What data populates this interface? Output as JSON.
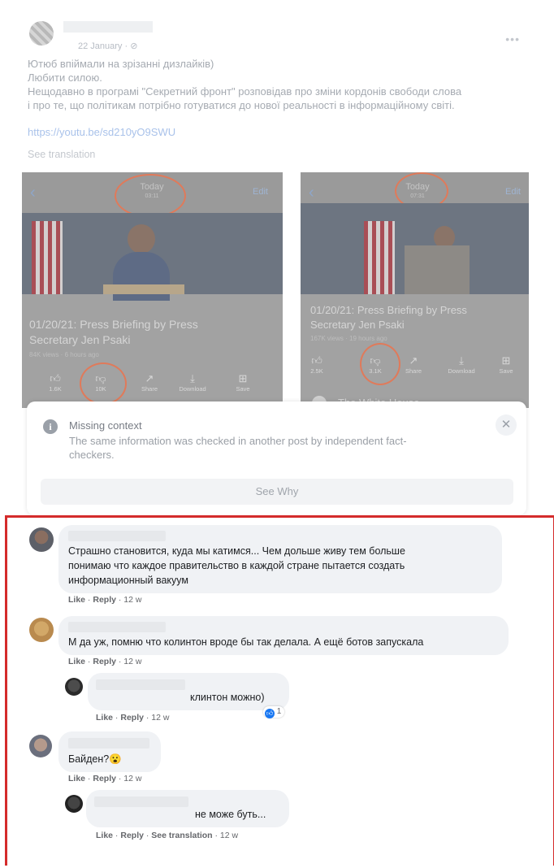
{
  "post": {
    "date": "22 January · ⊘",
    "menu_icon": "more-icon",
    "text_lines": [
      "Ютюб впіймали на зрізанні дизлайків)",
      "Любити силою.",
      "Нещодавно в програмі \"Секретний фронт\" розповідав про зміни кордонів свободи слова",
      "і про те, що політикам потрібно готуватися до нової реальності в інформаційному світі."
    ],
    "link": "https://youtu.be/sd210yO9SWU",
    "see_translation": "See translation"
  },
  "screenshot_left": {
    "today": "Today",
    "time": "03:11",
    "edit": "Edit",
    "title_line1": "01/20/21: Press Briefing by Press",
    "title_line2": "Secretary Jen Psaki",
    "meta": "84K views · 6 hours ago",
    "actions": [
      {
        "icon": "thumbs-up-icon",
        "label": "1.6K"
      },
      {
        "icon": "thumbs-down-icon",
        "label": "10K"
      },
      {
        "icon": "share-icon",
        "label": "Share"
      },
      {
        "icon": "download-icon",
        "label": "Download"
      },
      {
        "icon": "save-icon",
        "label": "Save"
      }
    ]
  },
  "screenshot_right": {
    "today": "Today",
    "time": "07:31",
    "edit": "Edit",
    "title_line1": "01/20/21: Press Briefing by Press",
    "title_line2": "Secretary Jen Psaki",
    "meta": "167K views · 19 hours ago",
    "actions": [
      {
        "icon": "thumbs-up-icon",
        "label": "2.5K"
      },
      {
        "icon": "thumbs-down-icon",
        "label": "3.1K"
      },
      {
        "icon": "share-icon",
        "label": "Share"
      },
      {
        "icon": "download-icon",
        "label": "Download"
      },
      {
        "icon": "save-icon",
        "label": "Save"
      }
    ],
    "channel": "The White House"
  },
  "missing_context": {
    "title": "Missing context",
    "line1": "The same information was checked in another post by independent fact-",
    "line2": "checkers.",
    "button": "See Why"
  },
  "comments": [
    {
      "lines": [
        "Страшно становится, куда мы катимся... Чем дольше живу тем больше",
        "понимаю что каждое правительство в каждой стране пытается создать",
        "информационный вакуум"
      ],
      "like": "Like",
      "reply": "Reply",
      "time": "12 w"
    },
    {
      "lines": [
        "М да уж, помню что колинтон вроде бы так делала. А ещё ботов запускала"
      ],
      "like": "Like",
      "reply": "Reply",
      "time": "12 w"
    },
    {
      "lines": [
        "клинтон можно)"
      ],
      "like": "Like",
      "reply": "Reply",
      "time": "12 w",
      "reaction_count": "1"
    },
    {
      "lines": [
        "Байден?😮"
      ],
      "like": "Like",
      "reply": "Reply",
      "time": "12 w"
    },
    {
      "lines": [
        "не може буть..."
      ],
      "like": "Like",
      "reply": "Reply",
      "see_translation": "See translation",
      "time": "12 w"
    }
  ],
  "colors": {
    "highlight_border": "#d42b2b",
    "annotation_circle": "#e07a5a",
    "facebook_blue": "#1877f2"
  }
}
